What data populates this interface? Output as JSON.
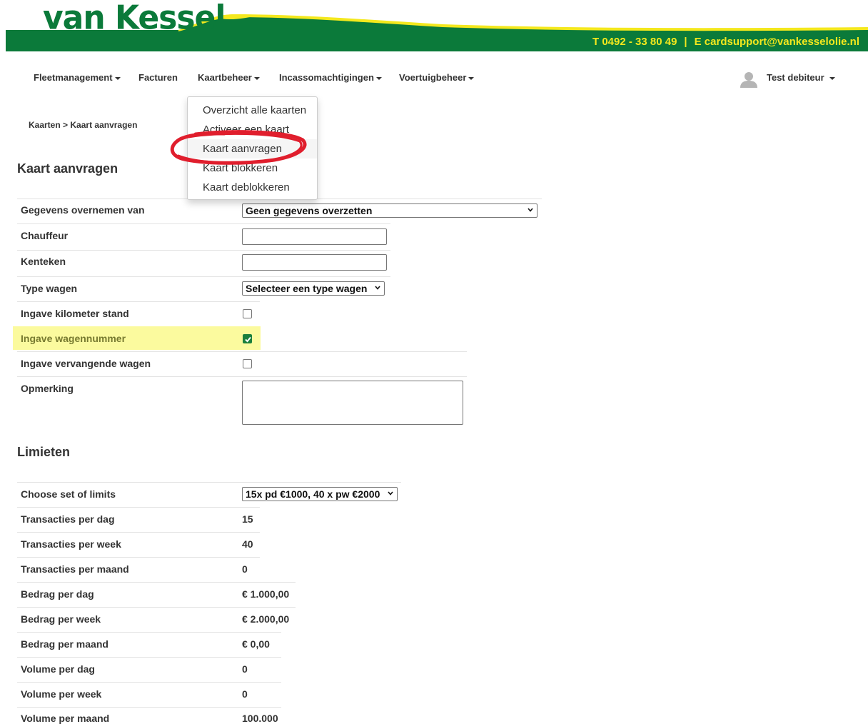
{
  "brand": {
    "logo_text": "van Kessel",
    "phone": "T  0492 - 33 80 49",
    "separator": "|",
    "email": "E  cardsupport@vankesselolie.nl",
    "colors": {
      "green": "#0b7a3a",
      "yellow": "#f4e81d"
    }
  },
  "nav": {
    "items": [
      {
        "label": "Fleetmanagement",
        "dropdown": true
      },
      {
        "label": "Facturen",
        "dropdown": false
      },
      {
        "label": "Kaartbeheer",
        "dropdown": true
      },
      {
        "label": "Incassomachtigingen",
        "dropdown": true
      },
      {
        "label": "Voertuigbeheer",
        "dropdown": true
      }
    ],
    "user": {
      "name": "Test debiteur",
      "icon": "user-icon"
    }
  },
  "dropdown_menu": {
    "items": [
      "Overzicht alle kaarten",
      "Activeer een kaart",
      "Kaart aanvragen",
      "Kaart blokkeren",
      "Kaart deblokkeren"
    ],
    "active": "Kaart aanvragen",
    "annotation_color": "#e01e2d"
  },
  "breadcrumb": {
    "parent": "Kaarten",
    "separator": ">",
    "current": "Kaart aanvragen"
  },
  "form": {
    "title": "Kaart aanvragen",
    "fields": {
      "gegevens": {
        "label": "Gegevens overnemen van",
        "value": "Geen gegevens overzetten"
      },
      "chauffeur": {
        "label": "Chauffeur",
        "value": ""
      },
      "kenteken": {
        "label": "Kenteken",
        "value": ""
      },
      "type_wagen": {
        "label": "Type wagen",
        "value": "Selecteer een type wagen"
      },
      "km_stand": {
        "label": "Ingave kilometer stand",
        "checked": false
      },
      "wagennummer": {
        "label": "Ingave wagennummer",
        "checked": true,
        "highlight_color": "#fbfa9e"
      },
      "vervangende": {
        "label": "Ingave vervangende wagen",
        "checked": false
      },
      "opmerking": {
        "label": "Opmerking",
        "value": ""
      }
    }
  },
  "limits": {
    "title": "Limieten",
    "set": {
      "label": "Choose set of limits",
      "value": "15x pd €1000, 40 x pw €2000"
    },
    "rows": [
      {
        "label": "Transacties per dag",
        "value": "15"
      },
      {
        "label": "Transacties per week",
        "value": "40"
      },
      {
        "label": "Transacties per maand",
        "value": "0"
      },
      {
        "label": "Bedrag per dag",
        "value": "€ 1.000,00"
      },
      {
        "label": "Bedrag per week",
        "value": "€ 2.000,00"
      },
      {
        "label": "Bedrag per maand",
        "value": "€ 0,00"
      },
      {
        "label": "Volume per dag",
        "value": "0"
      },
      {
        "label": "Volume per week",
        "value": "0"
      },
      {
        "label": "Volume per maand",
        "value": "100.000"
      }
    ]
  }
}
